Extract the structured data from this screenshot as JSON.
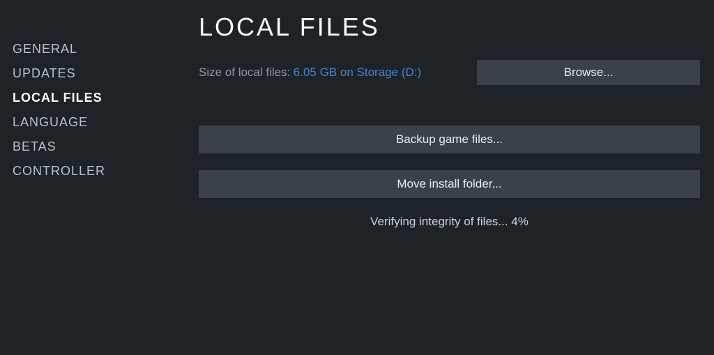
{
  "sidebar": {
    "items": [
      {
        "label": "GENERAL",
        "active": false
      },
      {
        "label": "UPDATES",
        "active": false
      },
      {
        "label": "LOCAL FILES",
        "active": true
      },
      {
        "label": "LANGUAGE",
        "active": false
      },
      {
        "label": "BETAS",
        "active": false
      },
      {
        "label": "CONTROLLER",
        "active": false
      }
    ]
  },
  "main": {
    "title": "LOCAL FILES",
    "size_label": "Size of local files:",
    "size_value": "6.05 GB on Storage (D:)",
    "browse_label": "Browse...",
    "backup_label": "Backup game files...",
    "move_label": "Move install folder...",
    "status": "Verifying integrity of files... 4%"
  }
}
